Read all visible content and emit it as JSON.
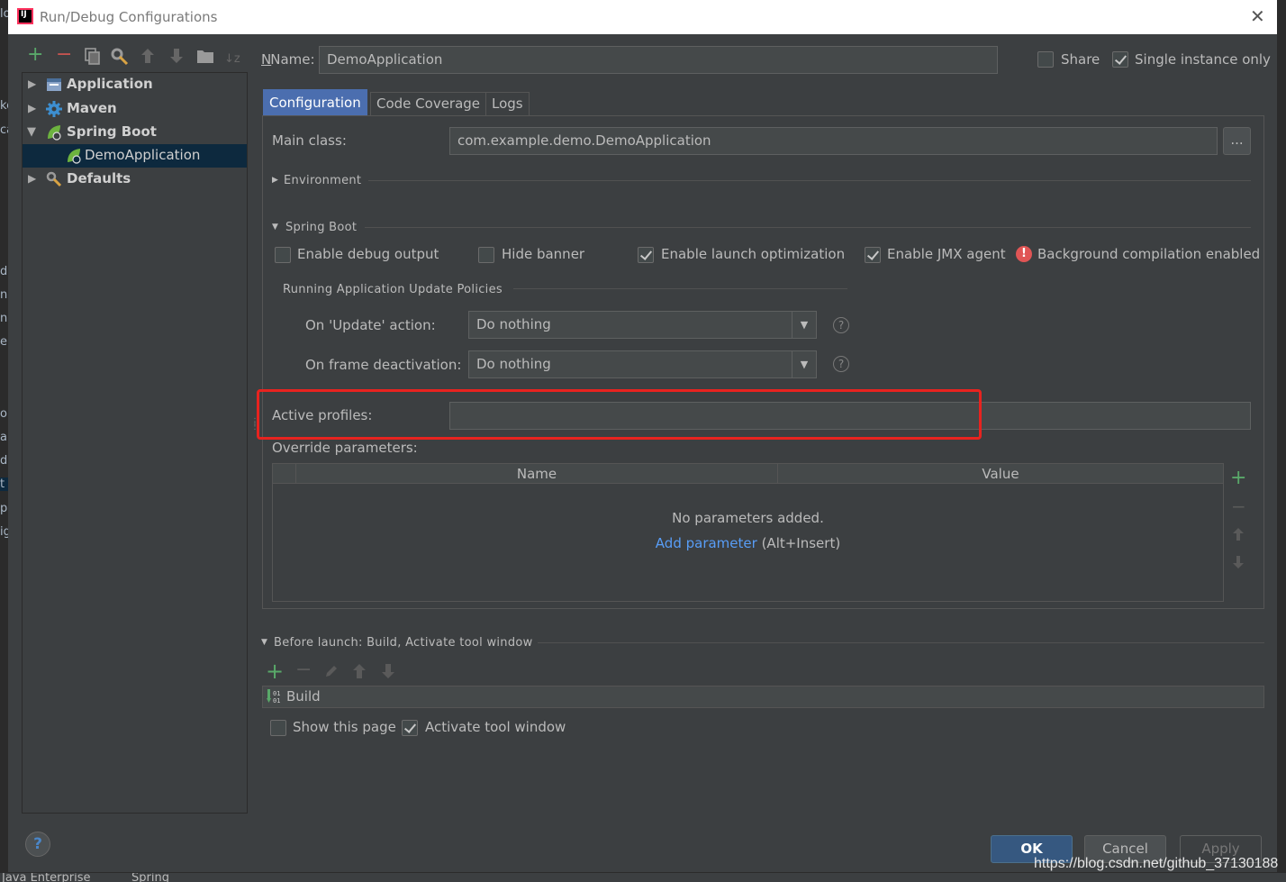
{
  "window": {
    "title": "Run/Debug Configurations",
    "close_glyph": "✕"
  },
  "toolbar": {
    "icons": [
      "add-icon",
      "remove-icon",
      "copy-icon",
      "wrench-icon",
      "move-up-icon",
      "move-down-icon",
      "folder-icon",
      "sort-icon"
    ]
  },
  "tree": {
    "items": [
      {
        "label": "Application",
        "icon": "application-icon",
        "expanded": false
      },
      {
        "label": "Maven",
        "icon": "maven-gear-icon",
        "expanded": false
      },
      {
        "label": "Spring Boot",
        "icon": "spring-boot-icon",
        "expanded": true
      },
      {
        "label": "DemoApplication",
        "icon": "spring-app-icon",
        "selected": true
      },
      {
        "label": "Defaults",
        "icon": "defaults-wrench-icon",
        "expanded": false
      }
    ]
  },
  "name_row": {
    "label": "Name:",
    "value": "DemoApplication",
    "share_label": "Share",
    "share_checked": false,
    "single_instance_label": "Single instance only",
    "single_instance_checked": true
  },
  "tabs": [
    {
      "label": "Configuration",
      "active": true
    },
    {
      "label": "Code Coverage",
      "active": false
    },
    {
      "label": "Logs",
      "active": false
    }
  ],
  "config": {
    "main_class_label": "Main class:",
    "main_class_value": "com.example.demo.DemoApplication",
    "browse_label": "...",
    "environment_label": "Environment",
    "spring_boot_label": "Spring Boot",
    "checkboxes": [
      {
        "label": "Enable debug output",
        "checked": false
      },
      {
        "label": "Hide banner",
        "checked": false
      },
      {
        "label": "Enable launch optimization",
        "checked": true
      },
      {
        "label": "Enable JMX agent",
        "checked": true
      }
    ],
    "bg_compilation_label": "Background compilation enabled",
    "policies_label": "Running Application Update Policies",
    "update_action_label": "On 'Update' action:",
    "update_action_value": "Do nothing",
    "frame_deactivation_label": "On frame deactivation:",
    "frame_deactivation_value": "Do nothing",
    "help_glyph": "?",
    "active_profiles_label": "Active profiles:",
    "active_profiles_value": "",
    "override_label": "Override parameters:",
    "table": {
      "columns": [
        "Name",
        "Value"
      ],
      "empty_text": "No parameters added.",
      "add_link": "Add parameter",
      "add_shortcut": "(Alt+Insert)"
    }
  },
  "before_launch": {
    "label": "Before launch: Build, Activate tool window",
    "items": [
      "Build"
    ],
    "show_page_label": "Show this page",
    "show_page_checked": false,
    "activate_tool_label": "Activate tool window",
    "activate_tool_checked": true
  },
  "buttons": {
    "ok": "OK",
    "cancel": "Cancel",
    "apply": "Apply",
    "help": "?"
  },
  "taskbar": {
    "items": [
      "Java Enterprise",
      "Spring"
    ]
  },
  "watermark": "https://blog.csdn.net/github_37130188",
  "background_fragments": [
    "lo",
    "ke",
    "ca",
    "de",
    "n",
    "n",
    "e",
    "op",
    "a",
    "di",
    "t",
    "pe",
    "ig"
  ],
  "colors": {
    "accent": "#4b6eaf",
    "ok_button": "#365880",
    "highlight_box": "#e8231f",
    "link": "#589df6",
    "add_green": "#59a869",
    "remove_red": "#c75450"
  }
}
